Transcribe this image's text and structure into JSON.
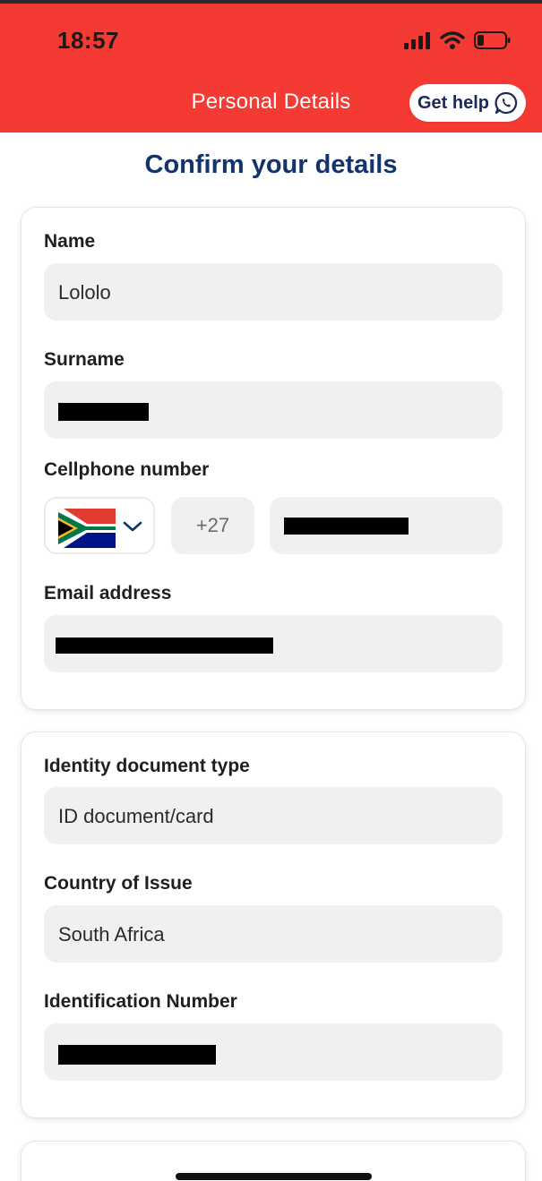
{
  "status_bar": {
    "time": "18:57"
  },
  "header": {
    "title": "Personal Details",
    "help_button_label": "Get help",
    "background_color": "#f43a32"
  },
  "page": {
    "title": "Confirm your details",
    "title_color": "#13336a"
  },
  "contact_card": {
    "name": {
      "label": "Name",
      "value": "Lololo"
    },
    "surname": {
      "label": "Surname"
    },
    "cellphone": {
      "label": "Cellphone number",
      "dial_code": "+27",
      "country_flag": "south-africa-flag-icon"
    },
    "email": {
      "label": "Email address"
    }
  },
  "identity_card": {
    "document_type": {
      "label": "Identity document type",
      "value": "ID document/card"
    },
    "country_of_issue": {
      "label": "Country of Issue",
      "value": "South Africa"
    },
    "id_number": {
      "label": "Identification Number"
    }
  }
}
